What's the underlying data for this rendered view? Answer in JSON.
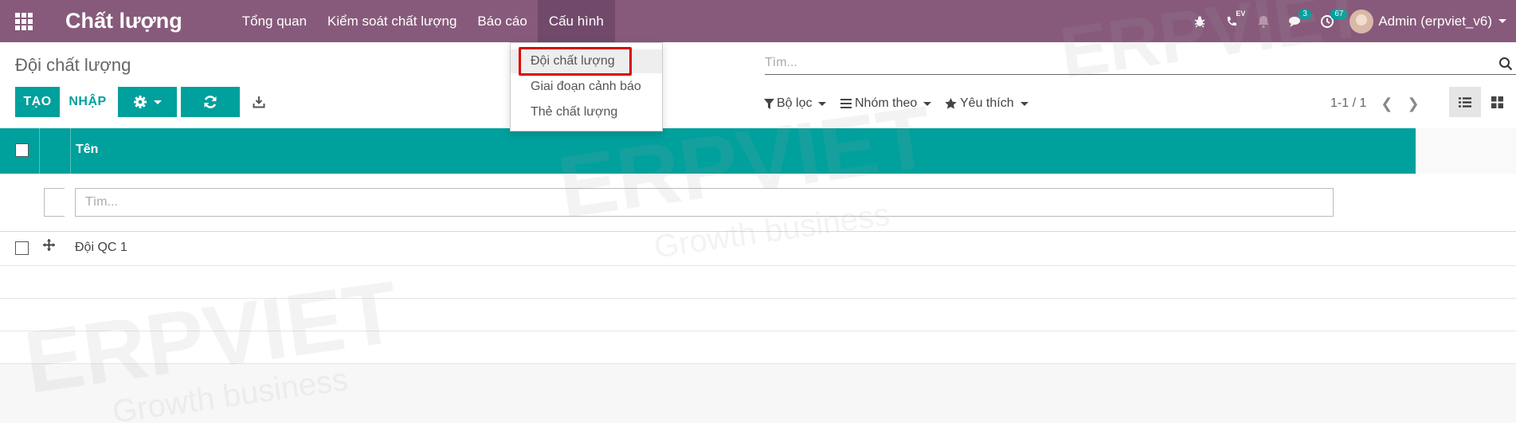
{
  "navbar": {
    "brand": "Chất lượng",
    "menus": [
      "Tổng quan",
      "Kiểm soát chất lượng",
      "Báo cáo",
      "Cấu hình"
    ],
    "ev_tag": "EV",
    "chat_badge": "3",
    "activity_badge": "67",
    "user_name": "Admin (erpviet_v6)"
  },
  "dropdown": {
    "items": [
      "Đội chất lượng",
      "Giai đoạn cảnh báo",
      "Thẻ chất lượng"
    ]
  },
  "control_panel": {
    "breadcrumb": "Đội chất lượng",
    "create_label": "TẠO",
    "import_label": "NHẬP",
    "search_placeholder": "Tìm...",
    "filter_label": "Bộ lọc",
    "group_label": "Nhóm theo",
    "favorite_label": "Yêu thích",
    "pager": "1-1 / 1"
  },
  "list": {
    "column_name": "Tên",
    "filter_placeholder": "Tìm...",
    "rows": [
      "Đội QC 1"
    ]
  },
  "watermark": {
    "brand": "ERPVIET",
    "tagline": "Growth business"
  },
  "colors": {
    "navbar": "#875a7b",
    "primary": "#00a09d",
    "highlight_box": "#dd0000"
  }
}
